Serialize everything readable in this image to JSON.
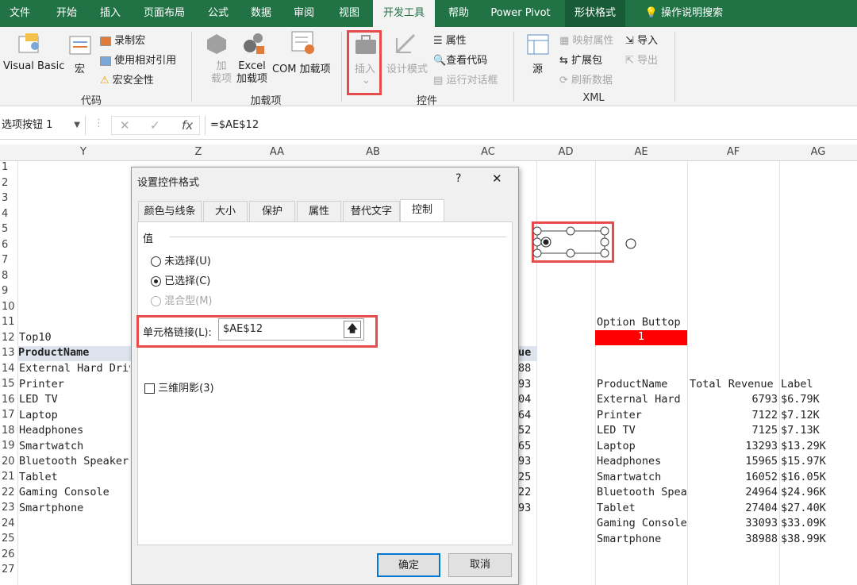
{
  "tabs": [
    "文件",
    "开始",
    "插入",
    "页面布局",
    "公式",
    "数据",
    "审阅",
    "视图",
    "开发工具",
    "帮助",
    "Power Pivot",
    "形状格式",
    "操作说明搜索"
  ],
  "ribbon": {
    "vb": "Visual Basic",
    "macro": "宏",
    "record": "录制宏",
    "relative": "使用相对引用",
    "security": "宏安全性",
    "g_code": "代码",
    "addin1": "加",
    "addin2": "载项",
    "excel1": "Excel",
    "excel2": "加载项",
    "com": "COM 加载项",
    "g_addins": "加载项",
    "insert": "插入",
    "design": "设计模式",
    "props": "属性",
    "viewcode": "查看代码",
    "rundialog": "运行对话框",
    "g_controls": "控件",
    "source": "源",
    "mapprops": "映射属性",
    "expand": "扩展包",
    "refresh": "刷新数据",
    "import": "导入",
    "export": "导出",
    "g_xml": "XML"
  },
  "formula": {
    "namebox": "选项按钮 1",
    "fx": "fx",
    "value": "=$AE$12"
  },
  "cols": [
    "Y",
    "Z",
    "AA",
    "AB",
    "AC",
    "AD",
    "AE",
    "AF",
    "AG"
  ],
  "rows": [
    "1",
    "2",
    "3",
    "4",
    "5",
    "6",
    "7",
    "8",
    "9",
    "10",
    "11",
    "12",
    "13",
    "14",
    "15",
    "16",
    "17",
    "18",
    "19",
    "20",
    "21",
    "22",
    "23",
    "24",
    "25",
    "26",
    "27"
  ],
  "left": {
    "top10": "Top10",
    "header": "ProductName",
    "hdr2": "ue",
    "items": [
      "External Hard Driv",
      "Printer",
      "LED TV",
      "Laptop",
      "Headphones",
      "Smartwatch",
      "Bluetooth Speaker",
      "Tablet",
      "Gaming Console",
      "Smartphone"
    ],
    "ac": [
      "88",
      "93",
      "04",
      "64",
      "52",
      "65",
      "93",
      "25",
      "22",
      "93"
    ]
  },
  "right": {
    "title": "Option Buttop",
    "value": "1",
    "h1": "ProductName",
    "h2": "Total Revenue",
    "h3": "Label",
    "rows": [
      [
        "External Hard",
        "6793",
        "$6.79K"
      ],
      [
        "Printer",
        "7122",
        "$7.12K"
      ],
      [
        "LED TV",
        "7125",
        "$7.13K"
      ],
      [
        "Laptop",
        "13293",
        "$13.29K"
      ],
      [
        "Headphones",
        "15965",
        "$15.97K"
      ],
      [
        "Smartwatch",
        "16052",
        "$16.05K"
      ],
      [
        "Bluetooth Spea",
        "24964",
        "$24.96K"
      ],
      [
        "Tablet",
        "27404",
        "$27.40K"
      ],
      [
        "Gaming Console",
        "33093",
        "$33.09K"
      ],
      [
        "Smartphone",
        "38988",
        "$38.99K"
      ]
    ]
  },
  "dialog": {
    "title": "设置控件格式",
    "help": "?",
    "close": "✕",
    "tabs": [
      "颜色与线条",
      "大小",
      "保护",
      "属性",
      "替代文字",
      "控制"
    ],
    "section": "值",
    "opt1": "未选择(U)",
    "opt2": "已选择(C)",
    "opt3": "混合型(M)",
    "link_label": "单元格链接(L):",
    "link_value": "$AE$12",
    "shadow": "三维阴影(3)",
    "ok": "确定",
    "cancel": "取消"
  },
  "colors": {
    "green": "#217346",
    "red": "#e64c4c",
    "cellred": "#ff0000"
  }
}
